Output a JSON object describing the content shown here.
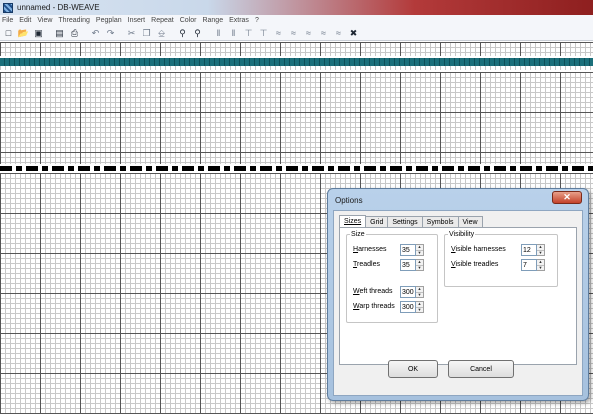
{
  "window": {
    "title": "unnamed - DB-WEAVE"
  },
  "menu": [
    "File",
    "Edit",
    "View",
    "Threading",
    "Pegplan",
    "Insert",
    "Repeat",
    "Color",
    "Range",
    "Extras",
    "?"
  ],
  "toolbar": {
    "icons": [
      "new-file-icon",
      "open-folder-icon",
      "save-icon",
      "print-preview-icon",
      "print-icon",
      "undo-icon",
      "redo-icon",
      "cut-icon",
      "copy-icon",
      "paste-icon",
      "zoom-in-icon",
      "zoom-out-icon",
      "threading-tool-icon",
      "pegplan-tool-icon",
      "range-tool-icon",
      "pattern-tool-icon",
      "color-tool-icon"
    ]
  },
  "dialog": {
    "title": "Options",
    "close_symbol": "✕",
    "tabs": [
      "Sizes",
      "Grid",
      "Settings",
      "Symbols",
      "View"
    ],
    "active_tab": "Sizes",
    "size_group": {
      "legend": "Size",
      "harnesses_label": "Harnesses",
      "harnesses_value": "35",
      "treadles_label": "Treadles",
      "treadles_value": "35",
      "weft_label": "Weft threads",
      "weft_value": "300",
      "warp_label": "Warp threads",
      "warp_value": "300"
    },
    "visibility_group": {
      "legend": "Visibility",
      "visible_harnesses_label": "Visible harnesses",
      "visible_harnesses_value": "12",
      "visible_treadles_label": "Visible treadles",
      "visible_treadles_value": "7"
    },
    "ok_label": "OK",
    "cancel_label": "Cancel"
  },
  "colors": {
    "threading_strip": "#1b6f7a",
    "dialog_frame": "#b9d1ea",
    "close_button": "#c4422a"
  }
}
